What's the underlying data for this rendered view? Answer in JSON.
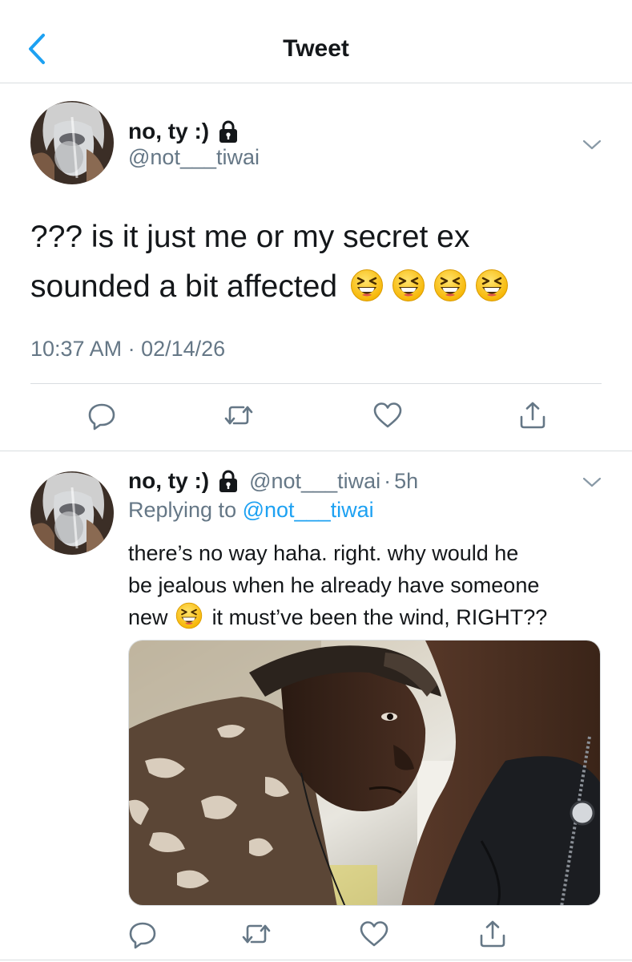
{
  "header": {
    "title": "Tweet"
  },
  "tweet": {
    "author": {
      "name": "no, ty :)",
      "handle": "@not___tiwai"
    },
    "text_line1": "??? is it just me or my secret ex",
    "text_line2": "sounded a bit affected",
    "emoji_name": "grinning-squinting-face",
    "emoji_count": 4,
    "timestamp": "10:37 AM · 02/14/26",
    "actions": [
      "reply-icon",
      "retweet-icon",
      "like-icon",
      "share-icon"
    ]
  },
  "reply": {
    "author": {
      "name": "no, ty :)",
      "handle": "@not___tiwai"
    },
    "separator": "·",
    "time": "5h",
    "replying_prefix": "Replying to",
    "replying_to": "@not___tiwai",
    "text_line1": "there’s no way haha. right. why would he",
    "text_line2": "be jealous when he already have someone",
    "text_line3_before": "new",
    "text_line3_after": "it must’ve been the wind, RIGHT??",
    "media": {
      "kind": "photo",
      "subject": "two men face to face in a close staredown"
    },
    "actions": [
      "reply-icon",
      "retweet-icon",
      "like-icon",
      "share-icon"
    ]
  },
  "colors": {
    "accent": "#1da1f2",
    "text_primary": "#14171a",
    "text_secondary": "#657786",
    "divider": "#d9dde0",
    "icon_gray": "#657786"
  }
}
